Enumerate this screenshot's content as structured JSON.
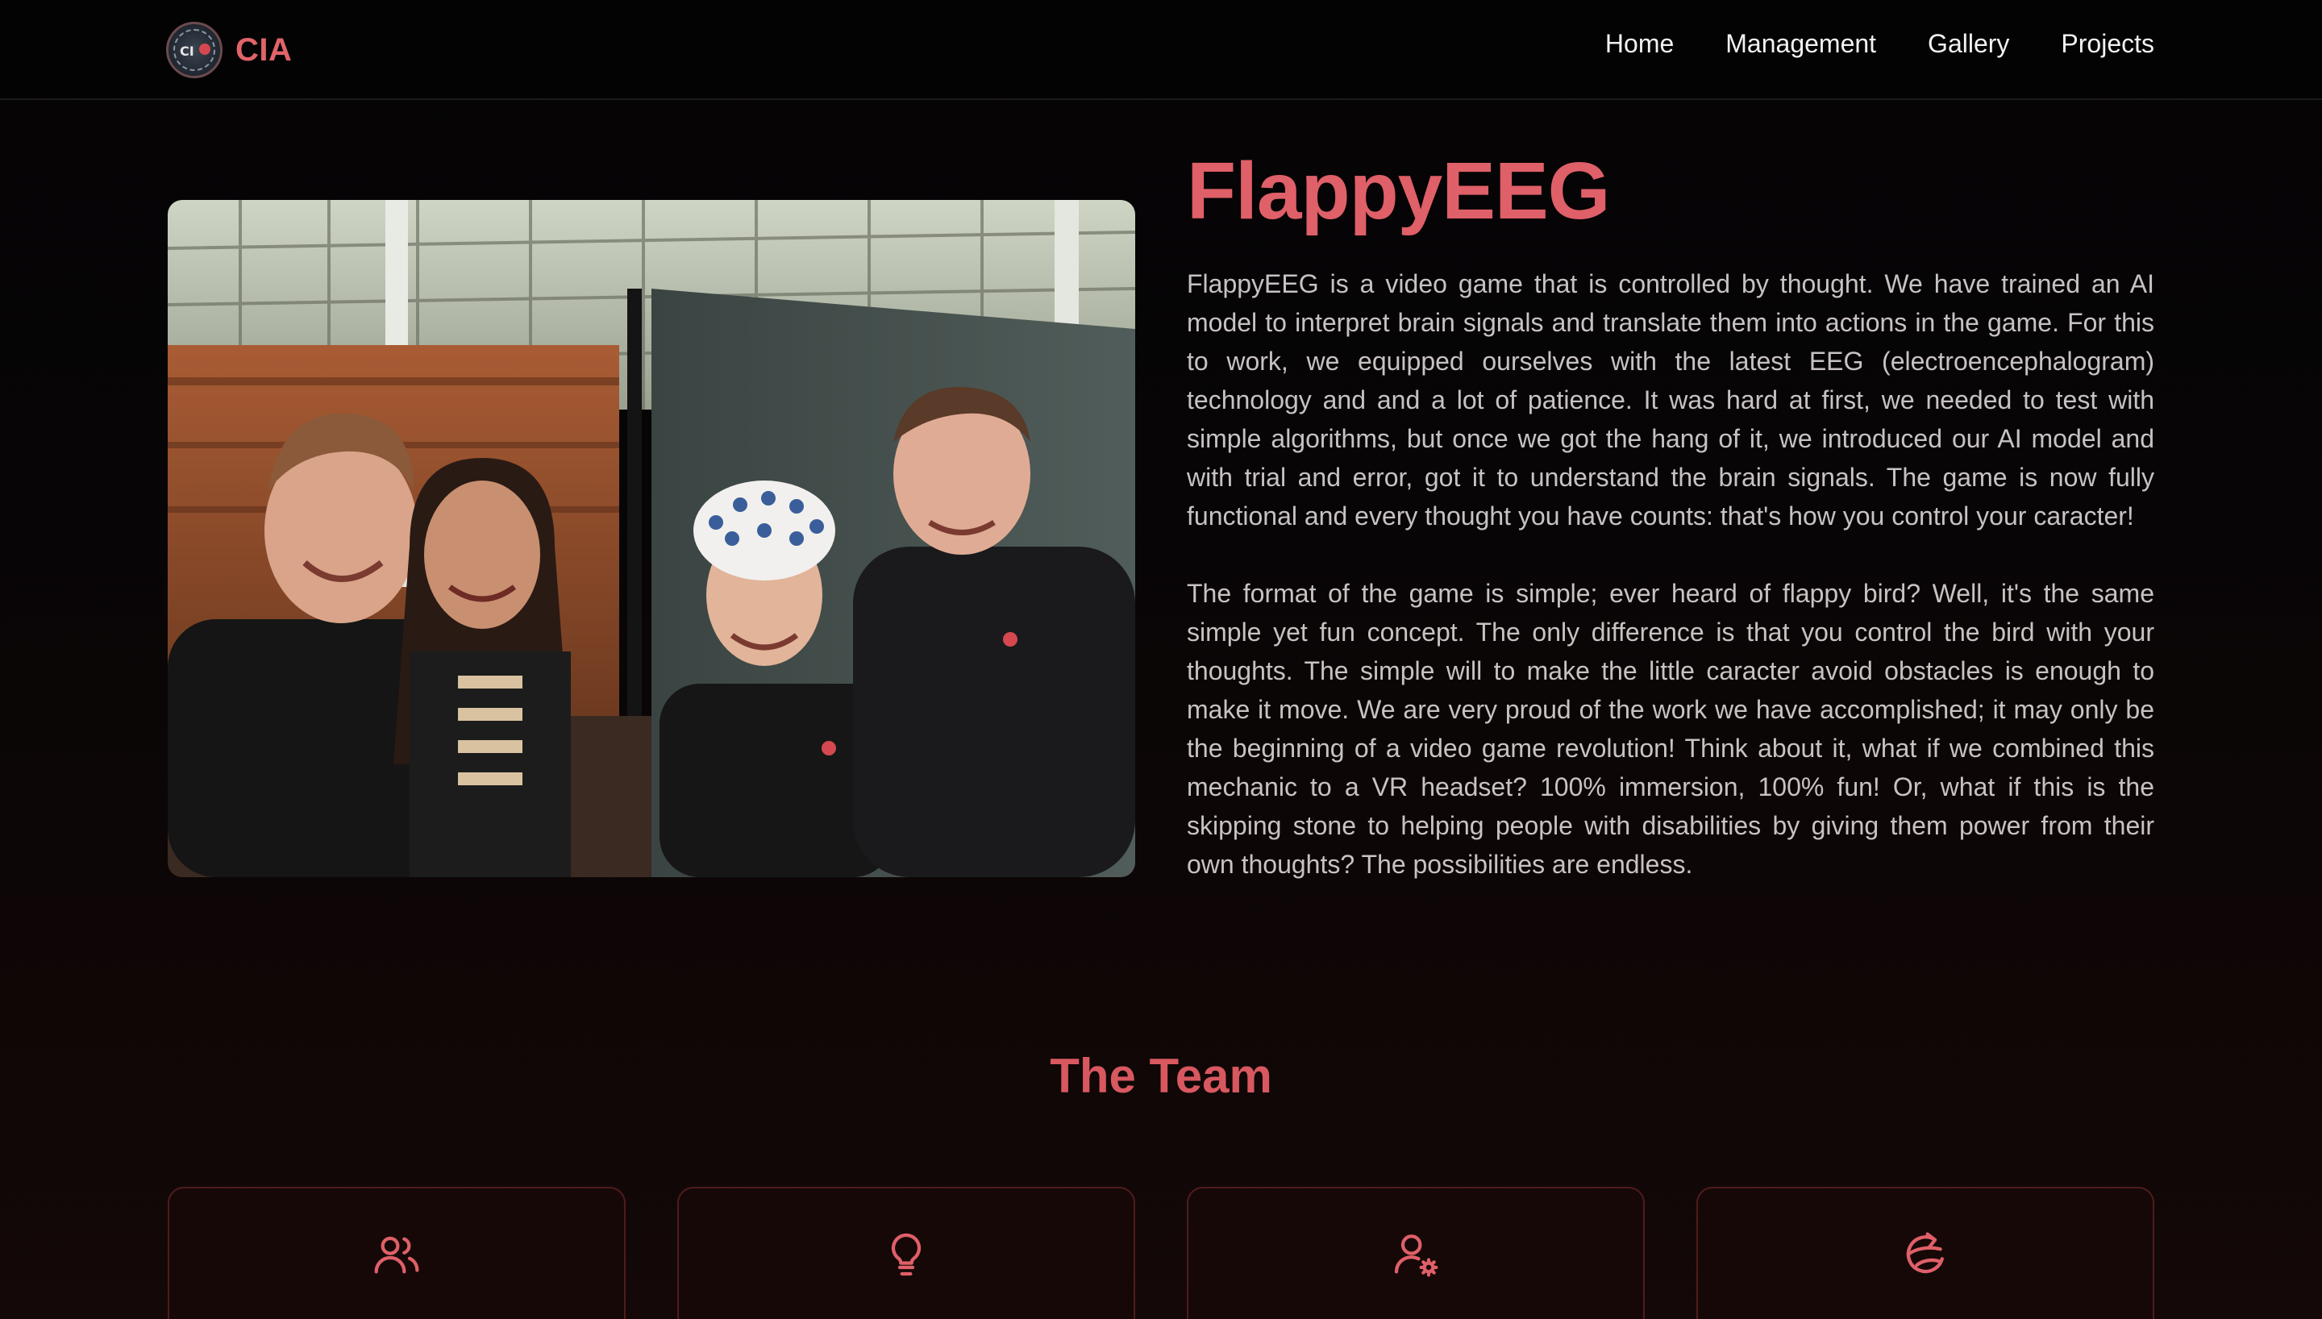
{
  "brand": {
    "name": "CIA",
    "logo_text": "CI"
  },
  "nav": {
    "items": [
      {
        "label": "Home"
      },
      {
        "label": "Management"
      },
      {
        "label": "Gallery"
      },
      {
        "label": "Projects"
      }
    ]
  },
  "project": {
    "title": "FlappyEEG",
    "paragraphs": [
      "FlappyEEG is a video game that is controlled by thought. We have trained an AI model to interpret brain signals and translate them into actions in the game. For this to work, we equipped ourselves with the latest EEG (electroencephalogram) technology and and a lot of patience. It was hard at first, we needed to test with simple algorithms, but once we got the hang of it, we introduced our AI model and with trial and error, got it to understand the brain signals. The game is now fully functional and every thought you have counts: that's how you control your caracter!",
      "The format of the game is simple; ever heard of flappy bird? Well, it's the same simple yet fun concept. The only difference is that you control the bird with your thoughts. The simple will to make the little caracter avoid obstacles is enough to make it move. We are very proud of the work we have accomplished; it may only be the beginning of a video game revolution! Think about it, what if we combined this mechanic to a VR headset? 100% immersion, 100% fun! Or, what if this is the skipping stone to helping people with disabilities by giving them power from their own thoughts? The possibilities are endless."
    ]
  },
  "team": {
    "heading": "The Team",
    "cards": [
      {
        "icon": "users-icon"
      },
      {
        "icon": "lightbulb-icon"
      },
      {
        "icon": "user-gear-icon"
      },
      {
        "icon": "orbit-icon"
      }
    ]
  },
  "colors": {
    "accent": "#df6068",
    "background": "#050405",
    "card_border": "#4f1c1c",
    "text": "#c8c2c2"
  }
}
